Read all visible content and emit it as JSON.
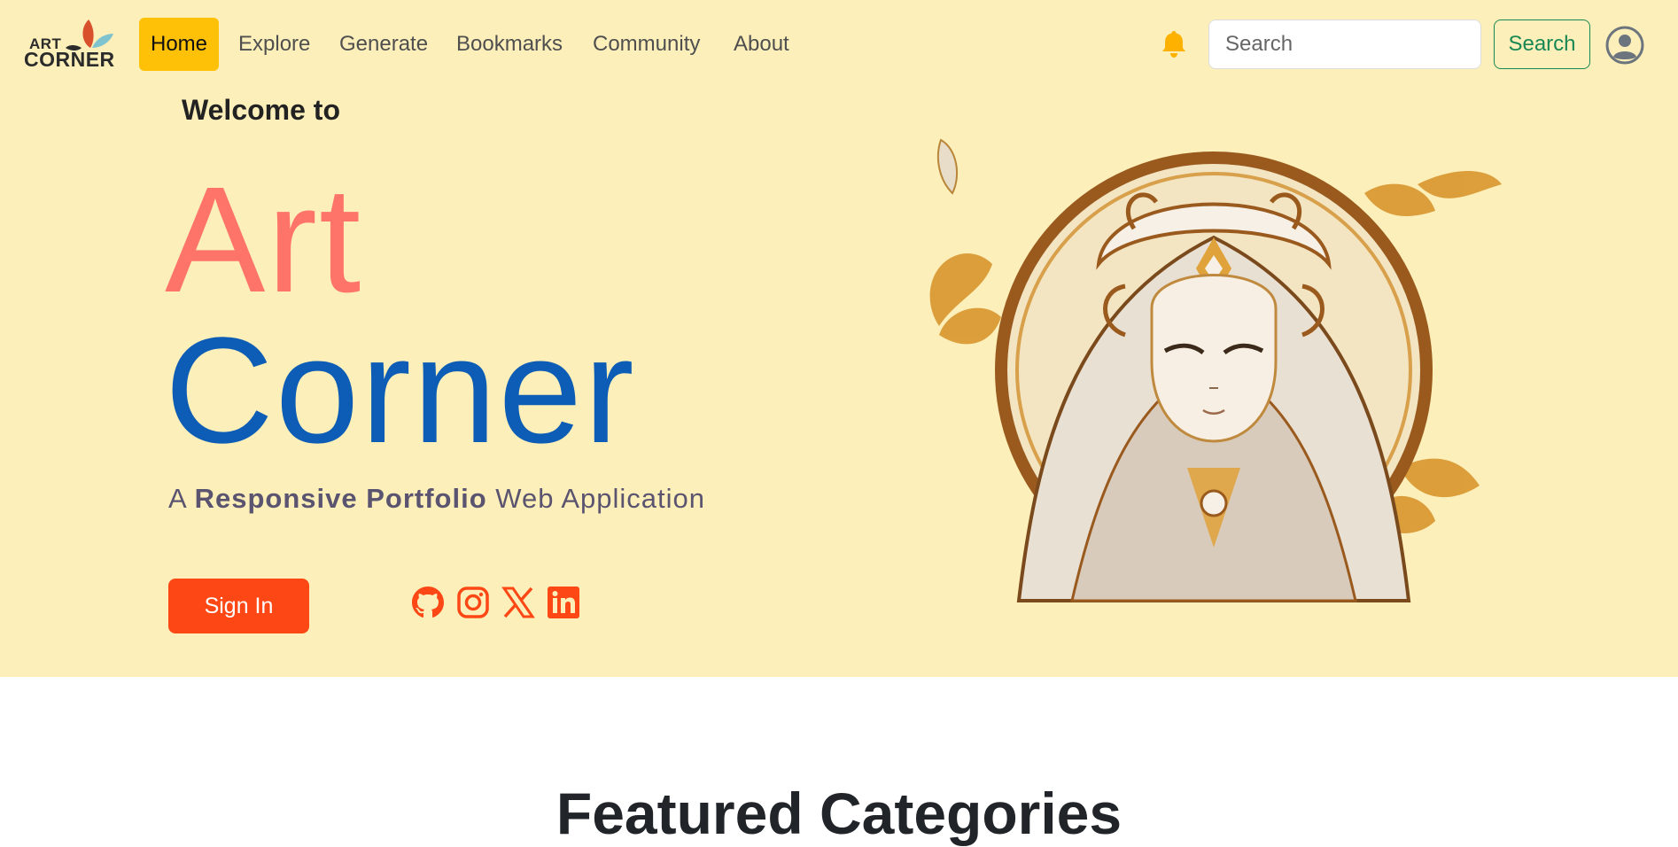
{
  "brand": {
    "logo_top": "ART",
    "logo_bottom": "CORNER"
  },
  "nav": {
    "links": [
      {
        "label": "Home"
      },
      {
        "label": "Explore"
      },
      {
        "label": "Generate"
      },
      {
        "label": "Bookmarks"
      },
      {
        "label": "Community"
      },
      {
        "label": "About"
      }
    ],
    "active": "Home"
  },
  "header": {
    "notification_icon": "bell-icon",
    "search_placeholder": "Search",
    "search_button": "Search",
    "profile_icon": "user-circle-icon"
  },
  "hero": {
    "welcome": "Welcome to",
    "title_line1": "Art",
    "title_line2": "Corner",
    "subtitle_prefix": "A",
    "subtitle_bold": "Responsive Portfolio",
    "subtitle_suffix": "Web Application",
    "signin_label": "Sign In",
    "social_icons": [
      "github-icon",
      "instagram-icon",
      "x-icon",
      "linkedin-icon"
    ]
  },
  "featured": {
    "heading": "Featured Categories"
  },
  "colors": {
    "hero_bg": "#fcefb9",
    "active_nav": "#ffc107",
    "art_title": "#ff7468",
    "corner_title": "#0d5cb5",
    "signin_bg": "#fd4714",
    "search_btn": "#198754",
    "bell": "#ffb100"
  }
}
